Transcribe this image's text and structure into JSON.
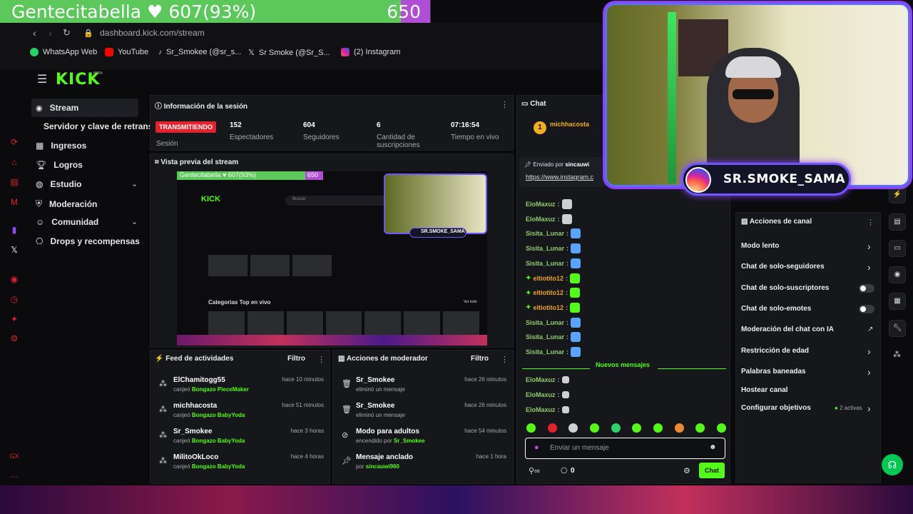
{
  "goal": {
    "text": "Gentecitabella ♥ 607(93%)",
    "count": "650",
    "progress": 0.93
  },
  "browser": {
    "url": "dashboard.kick.com/stream",
    "bookmarks": [
      "WhatsApp Web",
      "YouTube",
      "Sr_Smokee (@sr_s...",
      "Sr Smoke (@Sr_S...",
      "(2) Instagram"
    ]
  },
  "kick": {
    "logo": "KICK"
  },
  "sidebar": {
    "items": [
      "Stream",
      "Servidor y clave de retransm",
      "Ingresos",
      "Logros",
      "Estudio",
      "Moderación",
      "Comunidad",
      "Drops y recompensas"
    ]
  },
  "session": {
    "title": "Información de la sesión",
    "badge": "TRANSMITIENDO",
    "badge_label": "Sesión",
    "stats": [
      {
        "value": "152",
        "label": "Espectadores"
      },
      {
        "value": "604",
        "label": "Seguidores"
      },
      {
        "value": "6",
        "label": "Cantidad de suscripciones"
      },
      {
        "value": "07:16:54",
        "label": "Tiempo en vivo"
      }
    ]
  },
  "preview": {
    "title": "Vista previa del stream",
    "mini_goal": "Gentecitabella ♥ 607(93%)",
    "mini_count": "650",
    "mini_logo": "KICK",
    "mini_search": "Buscar",
    "mini_section": "Categorias Top en vivo",
    "mini_link": "Ver todo",
    "mini_label": "SR.SMOKE_SAMA"
  },
  "activity": {
    "title": "Feed de actividades",
    "filter": "Filtro",
    "rows": [
      {
        "name": "ElChamitogg55",
        "action": "canjeó",
        "item": "Bongazo PieceMaker",
        "time": "hace 10 minutos"
      },
      {
        "name": "michhacosta",
        "action": "canjeó",
        "item": "Bongazo BabyYoda",
        "time": "hace 51 minutos"
      },
      {
        "name": "Sr_Smokee",
        "action": "canjeó",
        "item": "Bongazo BabyYoda",
        "time": "hace 3 horas"
      },
      {
        "name": "MilitoOkLoco",
        "action": "canjeó",
        "item": "Bongazo BabyYoda",
        "time": "hace 4 horas"
      }
    ]
  },
  "modactions": {
    "title": "Acciones de moderador",
    "filter": "Filtro",
    "rows": [
      {
        "name": "Sr_Smokee",
        "action": "eliminó un mensaje",
        "item": "",
        "time": "hace 26 minutos"
      },
      {
        "name": "Sr_Smokee",
        "action": "eliminó un mensaje",
        "item": "",
        "time": "hace 26 minutos"
      },
      {
        "name": "Modo para adultos",
        "action": "encendido por",
        "item": "Sr_Smokee",
        "time": "hace 54 minutos"
      },
      {
        "name": "Mensaje anclado",
        "action": "por",
        "item": "sincauwi960",
        "time": "hace 1 hora"
      }
    ]
  },
  "chat": {
    "title": "Chat",
    "top_user": "michhacosta",
    "top_rank": "1",
    "pinned_by": "Enviado por",
    "pinned_user": "sincauwi",
    "pinned_link": "https://www.instagram.c",
    "new_messages": "Nuevos mensajes",
    "messages": [
      {
        "user": "EloMaxuz",
        "color": "#8ecb6e"
      },
      {
        "user": "EloMaxuz",
        "color": "#8ecb6e"
      },
      {
        "user": "Sisita_Lunar",
        "color": "#8ecb6e"
      },
      {
        "user": "Sisita_Lunar",
        "color": "#8ecb6e"
      },
      {
        "user": "Sisita_Lunar",
        "color": "#8ecb6e"
      },
      {
        "user": "eltiotito12",
        "color": "#f0a030"
      },
      {
        "user": "eltiotito12",
        "color": "#f0a030"
      },
      {
        "user": "eltiotito12",
        "color": "#f0a030"
      },
      {
        "user": "Sisita_Lunar",
        "color": "#8ecb6e"
      },
      {
        "user": "Sisita_Lunar",
        "color": "#8ecb6e"
      },
      {
        "user": "Sisita_Lunar",
        "color": "#8ecb6e"
      }
    ],
    "after_messages": [
      {
        "user": "EloMaxuz",
        "color": "#8ecb6e"
      },
      {
        "user": "EloMaxuz",
        "color": "#8ecb6e"
      },
      {
        "user": "EloMaxuz",
        "color": "#8ecb6e"
      }
    ],
    "placeholder": "Enviar un mensaje",
    "points": "0",
    "send": "Chat"
  },
  "channel": {
    "title": "Acciones de canal",
    "items": [
      {
        "label": "Modo lento",
        "control": "chevron"
      },
      {
        "label": "Chat de solo-seguidores",
        "control": "chevron"
      },
      {
        "label": "Chat de solo-suscriptores",
        "control": "toggle"
      },
      {
        "label": "Chat de solo-emotes",
        "control": "toggle"
      },
      {
        "label": "Moderación del chat con IA",
        "control": "external"
      },
      {
        "label": "Restricción de edad",
        "control": "chevron"
      },
      {
        "label": "Palabras baneadas",
        "control": "chevron"
      },
      {
        "label": "Hostear canal",
        "control": "none"
      },
      {
        "label": "Configurar objetivos",
        "control": "chevron"
      }
    ],
    "goals_active": "2 activas"
  },
  "overlay": {
    "label": "SR.SMOKE_SAMA"
  },
  "colors": {
    "kick_green": "#53fc18",
    "live_red": "#e0232e",
    "panel": "#16171b"
  }
}
